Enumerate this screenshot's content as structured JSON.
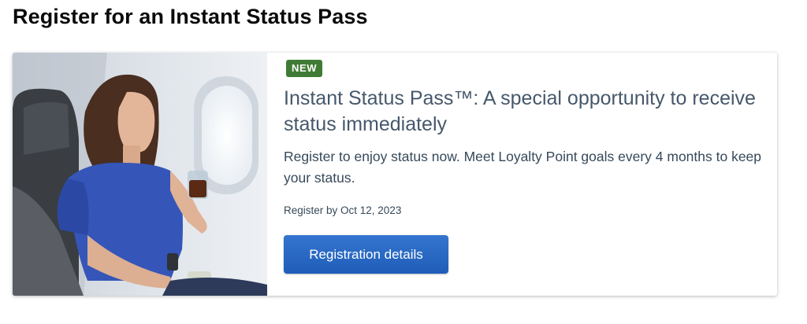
{
  "page": {
    "title": "Register for an Instant Status Pass"
  },
  "card": {
    "badge": "NEW",
    "title": "Instant Status Pass™: A special opportunity to receive status immediately",
    "description": "Register to enjoy status now. Meet Loyalty Point goals every 4 months to keep your status.",
    "deadline": "Register by Oct 12, 2023",
    "cta_label": "Registration details",
    "image_subject": "passenger-in-airplane-seat-holding-drink",
    "colors": {
      "badge": "#3f7b34",
      "button": "#2a68c1"
    }
  }
}
